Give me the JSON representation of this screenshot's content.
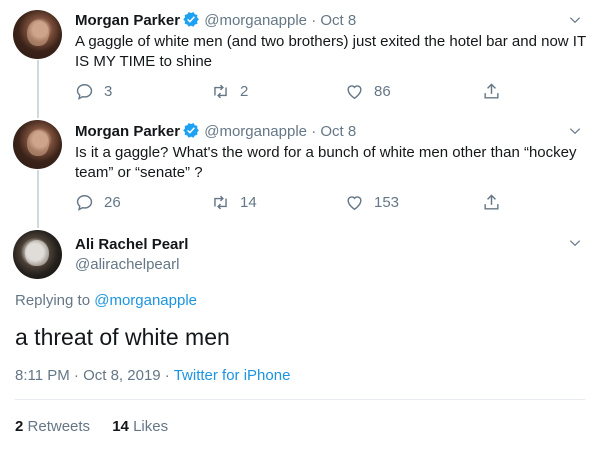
{
  "tweets": [
    {
      "name": "Morgan Parker",
      "handle": "@morganapple",
      "separator": "·",
      "date": "Oct 8",
      "text": "A gaggle of white men (and two brothers) just exited the hotel bar and now IT IS MY TIME to shine",
      "replies": "3",
      "retweets": "2",
      "likes": "86"
    },
    {
      "name": "Morgan Parker",
      "handle": "@morganapple",
      "separator": "·",
      "date": "Oct 8",
      "text": "Is it a gaggle? What's the word for a bunch of white men other than “hockey team” or “senate” ?",
      "replies": "26",
      "retweets": "14",
      "likes": "153"
    }
  ],
  "focus": {
    "name": "Ali Rachel Pearl",
    "handle": "@alirachelpearl",
    "replying_prefix": "Replying to ",
    "replying_to": "@morganapple",
    "text": "a threat of white men",
    "time": "8:11 PM · Oct 8, 2019 · ",
    "app": "Twitter for iPhone",
    "retweets_count": "2",
    "retweets_label": "Retweets",
    "likes_count": "14",
    "likes_label": "Likes"
  },
  "colors": {
    "link": "#1b95e0",
    "muted": "#657786",
    "verified": "#1da1f2"
  },
  "icons": [
    "verified-badge-icon",
    "chevron-down-icon",
    "reply-icon",
    "retweet-icon",
    "like-icon",
    "share-icon"
  ]
}
